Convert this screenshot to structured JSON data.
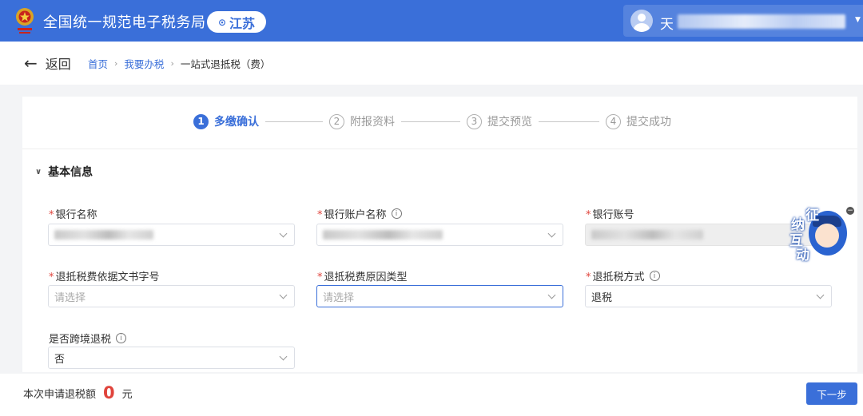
{
  "header": {
    "title": "全国统一规范电子税务局",
    "region": "江苏",
    "user_initial": "天",
    "color": "#3a6fd9"
  },
  "nav": {
    "back_label": "返回",
    "breadcrumb": [
      "首页",
      "我要办税",
      "一站式退抵税（费）"
    ]
  },
  "steps": [
    {
      "num": "1",
      "label": "多缴确认",
      "state": "active"
    },
    {
      "num": "2",
      "label": "附报资料",
      "state": "pending"
    },
    {
      "num": "3",
      "label": "提交预览",
      "state": "pending"
    },
    {
      "num": "4",
      "label": "提交成功",
      "state": "pending"
    }
  ],
  "section": {
    "title": "基本信息"
  },
  "form": {
    "bank_name": {
      "label": "银行名称",
      "required": true
    },
    "bank_account_name": {
      "label": "银行账户名称",
      "required": true,
      "info": true
    },
    "bank_account_no": {
      "label": "银行账号",
      "required": true
    },
    "refund_doc_no": {
      "label": "退抵税费依据文书字号",
      "required": true,
      "placeholder": "请选择"
    },
    "refund_reason_type": {
      "label": "退抵税费原因类型",
      "required": true,
      "placeholder": "请选择"
    },
    "refund_method": {
      "label": "退抵税方式",
      "required": true,
      "info": true,
      "value": "退税"
    },
    "cross_border": {
      "label": "是否跨境退税",
      "required": false,
      "info": true,
      "value": "否"
    }
  },
  "float_widget": {
    "chars": [
      "征",
      "纳",
      "互",
      "动"
    ]
  },
  "footer": {
    "amount_label": "本次申请退税额",
    "amount_value": "0",
    "amount_unit": "元",
    "next_label": "下一步",
    "accent": "#e0443c"
  }
}
